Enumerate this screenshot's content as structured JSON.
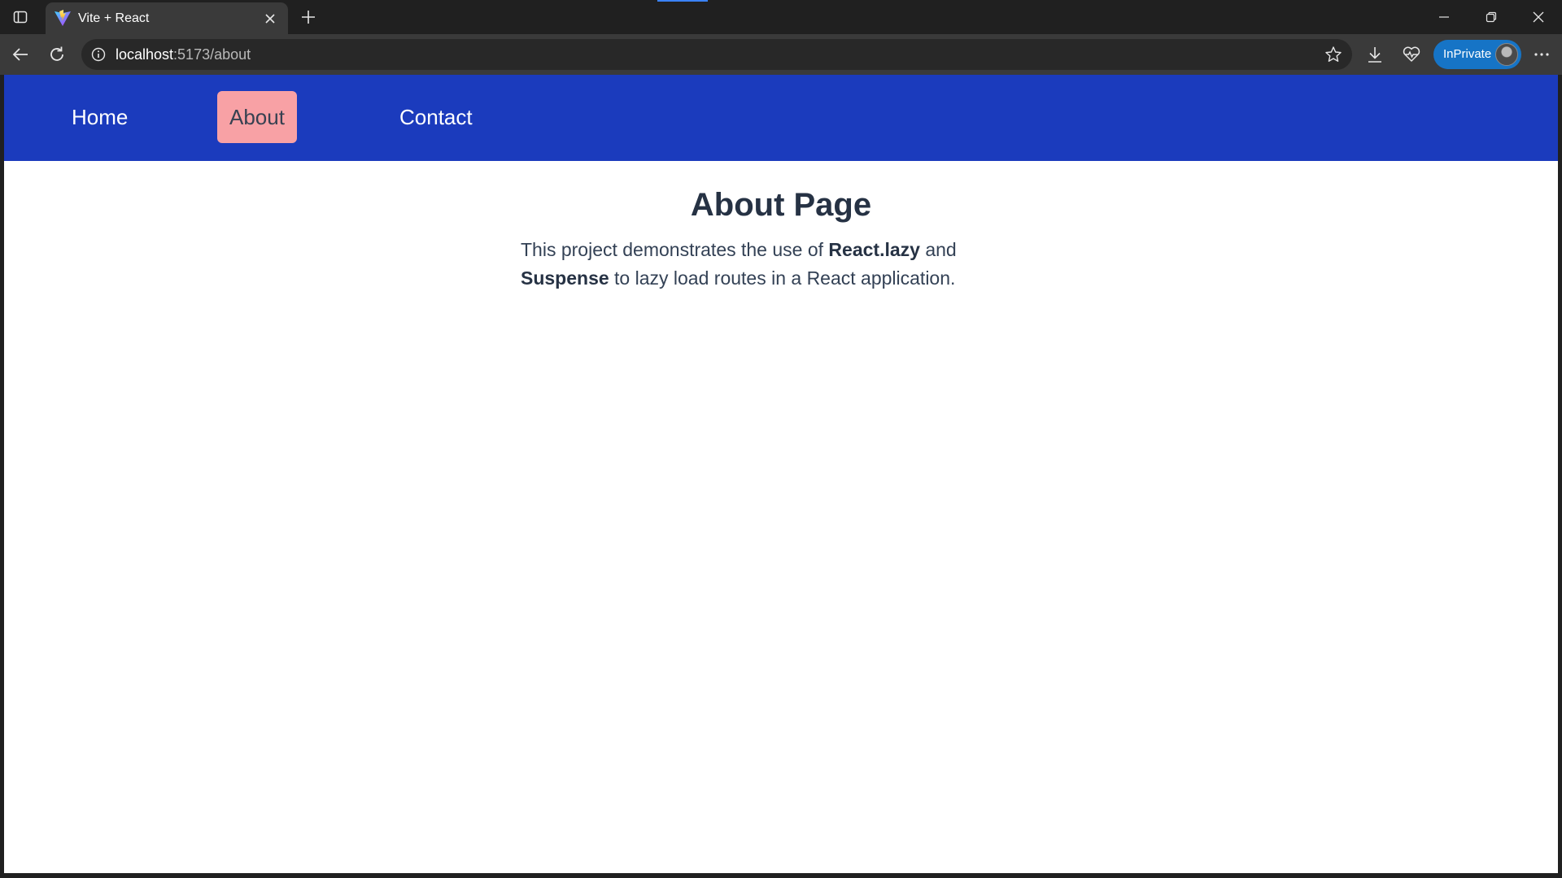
{
  "browser": {
    "tab": {
      "title": "Vite + React"
    },
    "address": {
      "host": "localhost",
      "path": ":5173/about"
    },
    "profile": {
      "label": "InPrivate"
    }
  },
  "page": {
    "nav": {
      "home": "Home",
      "about": "About",
      "contact": "Contact",
      "active": "About"
    },
    "title": "About Page",
    "paragraph": {
      "part1": "This project demonstrates the use of ",
      "bold1": "React.lazy",
      "part2": " and ",
      "bold2": "Suspense",
      "part3": " to lazy load routes in a React application."
    }
  },
  "colors": {
    "navbar": "#1b3bbd",
    "active_link": "#f8a1a5",
    "inprivate": "#1674c6"
  },
  "icons": [
    "sidebar-icon",
    "vite-logo-icon",
    "close-icon",
    "plus-icon",
    "minimize-icon",
    "restore-icon",
    "back-icon",
    "refresh-icon",
    "info-icon",
    "star-icon",
    "download-icon",
    "heartbeat-icon",
    "more-icon"
  ]
}
